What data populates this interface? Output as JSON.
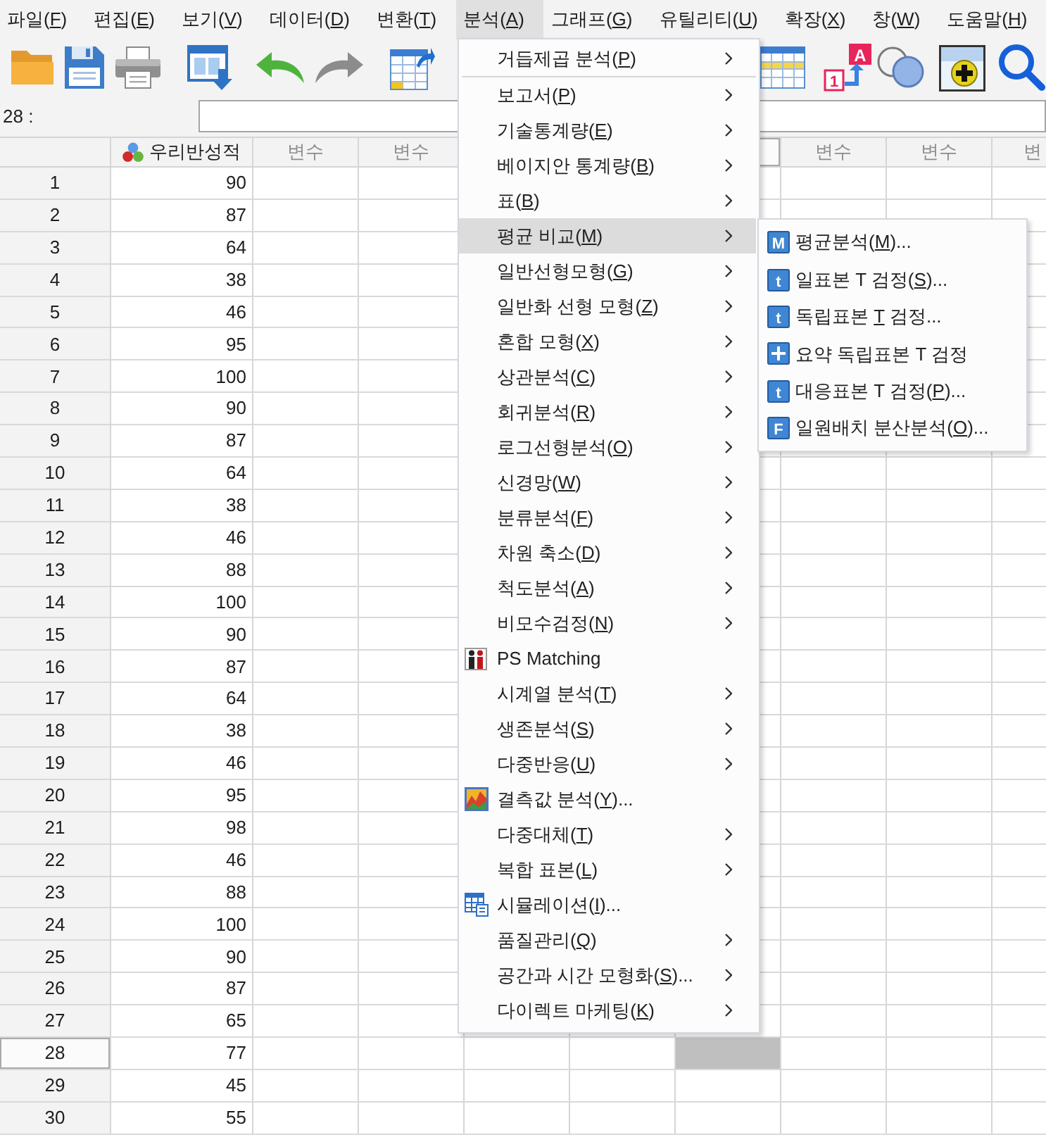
{
  "menu_bar": [
    {
      "text": "파일(",
      "mnemonic": "F",
      "text_after": ")",
      "selected": false
    },
    {
      "text": "편집(",
      "mnemonic": "E",
      "text_after": ")",
      "selected": false
    },
    {
      "text": "보기(",
      "mnemonic": "V",
      "text_after": ")",
      "selected": false
    },
    {
      "text": "데이터(",
      "mnemonic": "D",
      "text_after": ")",
      "selected": false
    },
    {
      "text": "변환(",
      "mnemonic": "T",
      "text_after": ")",
      "selected": false
    },
    {
      "text": "분석(",
      "mnemonic": "A",
      "text_after": ")",
      "selected": true
    },
    {
      "text": "그래프(",
      "mnemonic": "G",
      "text_after": ")",
      "selected": false
    },
    {
      "text": "유틸리티(",
      "mnemonic": "U",
      "text_after": ")",
      "selected": false
    },
    {
      "text": "확장(",
      "mnemonic": "X",
      "text_after": ")",
      "selected": false
    },
    {
      "text": "창(",
      "mnemonic": "W",
      "text_after": ")",
      "selected": false
    },
    {
      "text": "도움말(",
      "mnemonic": "H",
      "text_after": ")",
      "selected": false
    }
  ],
  "toolbar": {
    "left_items": [
      {
        "kind": "open"
      },
      {
        "kind": "save"
      },
      {
        "kind": "print"
      },
      {
        "kind": "recall"
      },
      {
        "kind": "undo"
      },
      {
        "kind": "redo"
      },
      {
        "kind": "goto"
      }
    ],
    "right_items": [
      {
        "kind": "table"
      },
      {
        "kind": "value_labels",
        "texts": [
          "A",
          "1"
        ]
      },
      {
        "kind": "sets"
      },
      {
        "kind": "add"
      },
      {
        "kind": "search"
      }
    ]
  },
  "cell_editor": {
    "label": "28 :"
  },
  "grid": {
    "columns": [
      {
        "label": "우리반성적",
        "kind": "variable",
        "selected": false
      },
      {
        "label": "변수",
        "kind": "placeholder",
        "selected": false
      },
      {
        "label": "변수",
        "kind": "placeholder",
        "selected": false
      },
      {
        "selected": false
      },
      {
        "selected": false
      },
      {
        "selected": true
      },
      {
        "label": "변수",
        "kind": "placeholder",
        "selected": false
      },
      {
        "label": "변수",
        "kind": "placeholder",
        "selected": false
      },
      {
        "label": "변",
        "kind": "placeholder",
        "selected": false
      }
    ],
    "rows": [
      {
        "number": "1",
        "values": [
          "90"
        ],
        "selected": false
      },
      {
        "number": "2",
        "values": [
          "87"
        ],
        "selected": false
      },
      {
        "number": "3",
        "values": [
          "64"
        ],
        "selected": false
      },
      {
        "number": "4",
        "values": [
          "38"
        ],
        "selected": false
      },
      {
        "number": "5",
        "values": [
          "46"
        ],
        "selected": false
      },
      {
        "number": "6",
        "values": [
          "95"
        ],
        "selected": false
      },
      {
        "number": "7",
        "values": [
          "100"
        ],
        "selected": false
      },
      {
        "number": "8",
        "values": [
          "90"
        ],
        "selected": false
      },
      {
        "number": "9",
        "values": [
          "87"
        ],
        "selected": false
      },
      {
        "number": "10",
        "values": [
          "64"
        ],
        "selected": false
      },
      {
        "number": "11",
        "values": [
          "38"
        ],
        "selected": false
      },
      {
        "number": "12",
        "values": [
          "46"
        ],
        "selected": false
      },
      {
        "number": "13",
        "values": [
          "88"
        ],
        "selected": false
      },
      {
        "number": "14",
        "values": [
          "100"
        ],
        "selected": false
      },
      {
        "number": "15",
        "values": [
          "90"
        ],
        "selected": false
      },
      {
        "number": "16",
        "values": [
          "87"
        ],
        "selected": false
      },
      {
        "number": "17",
        "values": [
          "64"
        ],
        "selected": false
      },
      {
        "number": "18",
        "values": [
          "38"
        ],
        "selected": false
      },
      {
        "number": "19",
        "values": [
          "46"
        ],
        "selected": false
      },
      {
        "number": "20",
        "values": [
          "95"
        ],
        "selected": false
      },
      {
        "number": "21",
        "values": [
          "98"
        ],
        "selected": false
      },
      {
        "number": "22",
        "values": [
          "46"
        ],
        "selected": false
      },
      {
        "number": "23",
        "values": [
          "88"
        ],
        "selected": false
      },
      {
        "number": "24",
        "values": [
          "100"
        ],
        "selected": false
      },
      {
        "number": "25",
        "values": [
          "90"
        ],
        "selected": false
      },
      {
        "number": "26",
        "values": [
          "87"
        ],
        "selected": false
      },
      {
        "number": "27",
        "values": [
          "65"
        ],
        "selected": false
      },
      {
        "number": "28",
        "values": [
          "77"
        ],
        "selected": true
      },
      {
        "number": "29",
        "values": [
          "45"
        ],
        "selected": false
      },
      {
        "number": "30",
        "values": [
          "55"
        ],
        "selected": false
      }
    ]
  },
  "analyze_menu": {
    "items": [
      {
        "text": "거듭제곱 분석(",
        "mnemonic": "P",
        "text_after": ")",
        "kind": "plain",
        "submenu": true,
        "selected": false
      },
      {
        "kind": "separator"
      },
      {
        "text": "보고서(",
        "mnemonic": "P",
        "text_after": ")",
        "kind": "plain",
        "submenu": true,
        "selected": false
      },
      {
        "text": "기술통계량(",
        "mnemonic": "E",
        "text_after": ")",
        "kind": "plain",
        "submenu": true,
        "selected": false
      },
      {
        "text": "베이지안 통계량(",
        "mnemonic": "B",
        "text_after": ")",
        "kind": "plain",
        "submenu": true,
        "selected": false
      },
      {
        "text": "표(",
        "mnemonic": "B",
        "text_after": ")",
        "kind": "plain",
        "submenu": true,
        "selected": false
      },
      {
        "text": "평균 비교(",
        "mnemonic": "M",
        "text_after": ")",
        "kind": "plain",
        "submenu": true,
        "selected": true
      },
      {
        "text": "일반선형모형(",
        "mnemonic": "G",
        "text_after": ")",
        "kind": "plain",
        "submenu": true,
        "selected": false
      },
      {
        "text": "일반화 선형 모형(",
        "mnemonic": "Z",
        "text_after": ")",
        "kind": "plain",
        "submenu": true,
        "selected": false
      },
      {
        "text": "혼합 모형(",
        "mnemonic": "X",
        "text_after": ")",
        "kind": "plain",
        "submenu": true,
        "selected": false
      },
      {
        "text": "상관분석(",
        "mnemonic": "C",
        "text_after": ")",
        "kind": "plain",
        "submenu": true,
        "selected": false
      },
      {
        "text": "회귀분석(",
        "mnemonic": "R",
        "text_after": ")",
        "kind": "plain",
        "submenu": true,
        "selected": false
      },
      {
        "text": "로그선형분석(",
        "mnemonic": "O",
        "text_after": ")",
        "kind": "plain",
        "submenu": true,
        "selected": false
      },
      {
        "text": "신경망(",
        "mnemonic": "W",
        "text_after": ")",
        "kind": "plain",
        "submenu": true,
        "selected": false
      },
      {
        "text": "분류분석(",
        "mnemonic": "F",
        "text_after": ")",
        "kind": "plain",
        "submenu": true,
        "selected": false
      },
      {
        "text": "차원 축소(",
        "mnemonic": "D",
        "text_after": ")",
        "kind": "plain",
        "submenu": true,
        "selected": false
      },
      {
        "text": "척도분석(",
        "mnemonic": "A",
        "text_after": ")",
        "kind": "plain",
        "submenu": true,
        "selected": false
      },
      {
        "text": "비모수검정(",
        "mnemonic": "N",
        "text_after": ")",
        "kind": "plain",
        "submenu": true,
        "selected": false
      },
      {
        "text": "PS Matching",
        "kind": "matching",
        "submenu": false,
        "selected": false
      },
      {
        "text": "시계열 분석(",
        "mnemonic": "T",
        "text_after": ")",
        "kind": "plain",
        "submenu": true,
        "selected": false
      },
      {
        "text": "생존분석(",
        "mnemonic": "S",
        "text_after": ")",
        "kind": "plain",
        "submenu": true,
        "selected": false
      },
      {
        "text": "다중반응(",
        "mnemonic": "U",
        "text_after": ")",
        "kind": "plain",
        "submenu": true,
        "selected": false
      },
      {
        "text": "결측값 분석(",
        "mnemonic": "Y",
        "text_after": ")...",
        "kind": "missing",
        "submenu": false,
        "selected": false
      },
      {
        "text": "다중대체(",
        "mnemonic": "T",
        "text_after": ")",
        "kind": "plain",
        "submenu": true,
        "selected": false
      },
      {
        "text": "복합 표본(",
        "mnemonic": "L",
        "text_after": ")",
        "kind": "plain",
        "submenu": true,
        "selected": false
      },
      {
        "text": "시뮬레이션(",
        "mnemonic": "I",
        "text_after": ")...",
        "kind": "simulation",
        "submenu": false,
        "selected": false
      },
      {
        "text": "품질관리(",
        "mnemonic": "Q",
        "text_after": ")",
        "kind": "plain",
        "submenu": true,
        "selected": false
      },
      {
        "text": "공간과 시간 모형화(",
        "mnemonic": "S",
        "text_after": ")...",
        "kind": "plain",
        "submenu": true,
        "selected": false
      },
      {
        "text": "다이렉트 마케팅(",
        "mnemonic": "K",
        "text_after": ")",
        "kind": "plain",
        "submenu": true,
        "selected": false
      }
    ]
  },
  "compare_means_submenu": {
    "items": [
      {
        "text": "평균분석(",
        "mnemonic": "M",
        "text_after": ")...",
        "kind": "letter",
        "icon_text": "M",
        "selected": false
      },
      {
        "text": "일표본 T 검정(",
        "mnemonic": "S",
        "text_after": ")...",
        "kind": "letter",
        "icon_text": "t",
        "selected": false
      },
      {
        "text": "독립표본 ",
        "mnemonic": "T",
        "text_after": " 검정...",
        "kind": "letter",
        "icon_text": "t",
        "selected": false
      },
      {
        "text": "요약 독립표본 T 검정",
        "kind": "plus",
        "selected": false
      },
      {
        "text": "대응표본 T 검정(",
        "mnemonic": "P",
        "text_after": ")...",
        "kind": "letter",
        "icon_text": "t",
        "selected": false
      },
      {
        "text": "일원배치 분산분석(",
        "mnemonic": "O",
        "text_after": ")...",
        "kind": "letter",
        "icon_text": "F",
        "selected": false
      }
    ]
  }
}
